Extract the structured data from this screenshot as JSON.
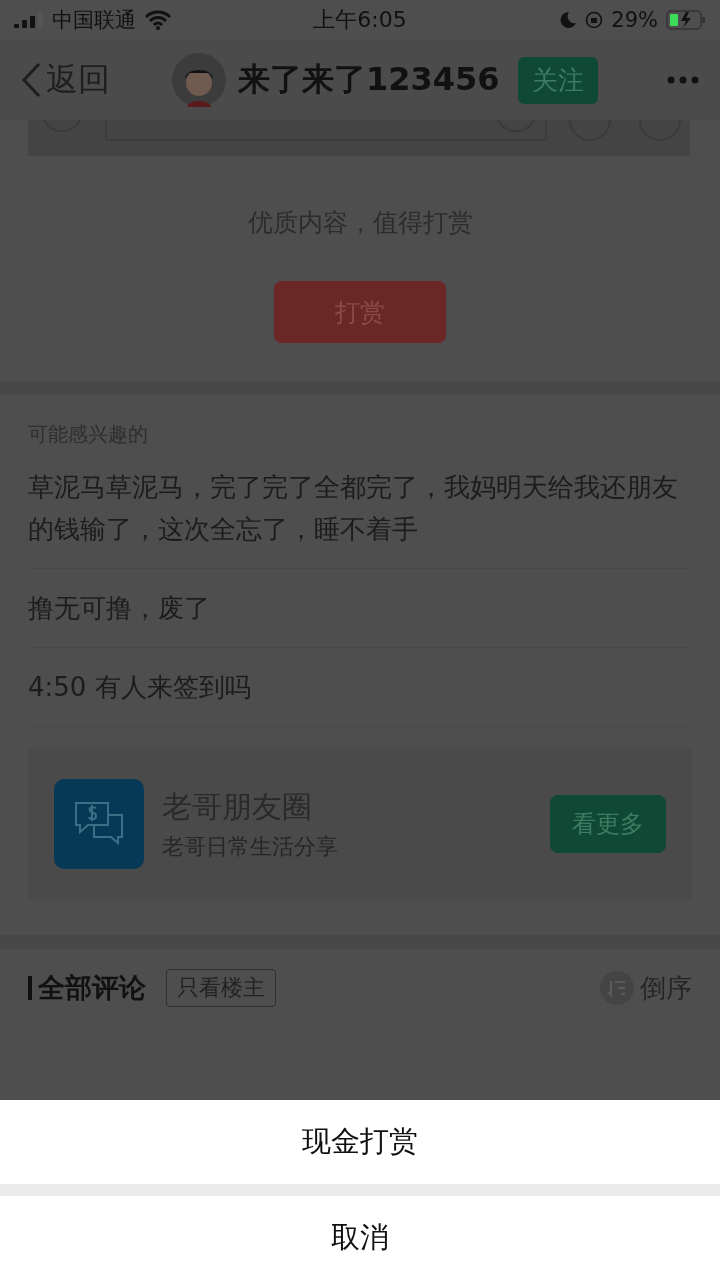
{
  "status_bar": {
    "carrier": "中国联通",
    "time": "上午6:05",
    "battery": "29%"
  },
  "nav": {
    "back": "返回",
    "title": "来了来了123456",
    "follow": {
      "label": "关注",
      "selected": false
    }
  },
  "reward": {
    "text": "优质内容，值得打赏",
    "button": "打赏"
  },
  "related": {
    "heading": "可能感兴趣的",
    "items": [
      "草泥马草泥马，完了完了全都完了，我妈明天给我还朋友的钱输了，这次全忘了，睡不着手",
      "撸无可撸，废了",
      "4:50 有人来签到吗"
    ]
  },
  "group_card": {
    "name": "老哥朋友圈",
    "subtitle": "老哥日常生活分享",
    "button": "看更多"
  },
  "comments": {
    "title": "全部评论",
    "filter": {
      "label": "只看楼主",
      "selected": false
    },
    "sort": "倒序"
  },
  "action_sheet": {
    "options": [
      "现金打赏"
    ],
    "cancel": "取消"
  }
}
